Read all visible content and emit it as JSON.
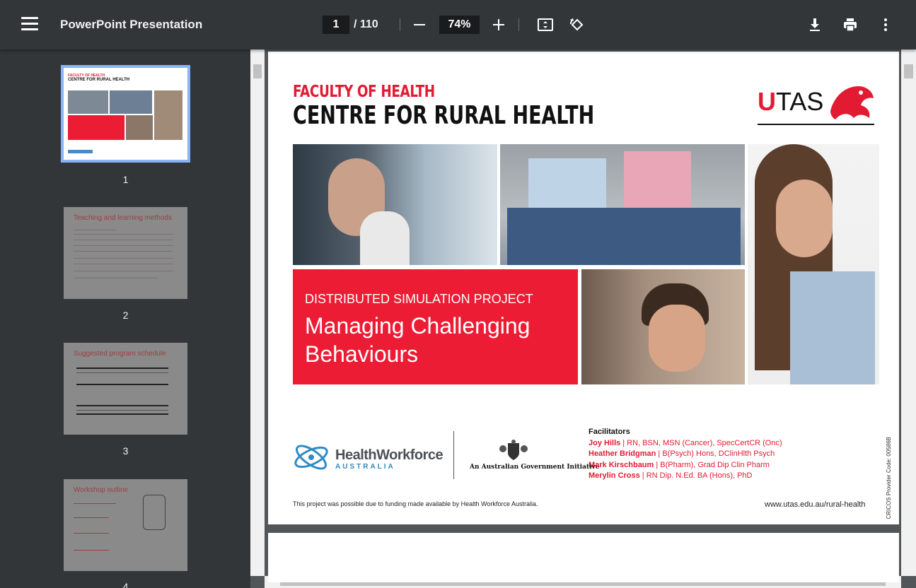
{
  "toolbar": {
    "title": "PowerPoint Presentation",
    "current_page": "1",
    "total_pages": "/ 110",
    "zoom": "74%"
  },
  "sidebar": {
    "thumbnails": [
      {
        "number": "1",
        "heading": ""
      },
      {
        "number": "2",
        "heading": "Teaching and learning methods"
      },
      {
        "number": "3",
        "heading": "Suggested program schedule"
      },
      {
        "number": "4",
        "heading": "Workshop outline"
      }
    ]
  },
  "slide": {
    "faculty": "FACULTY OF HEALTH",
    "centre": "CENTRE FOR RURAL HEALTH",
    "logo_u": "U",
    "logo_tas": "TAS",
    "project_label": "DISTRIBUTED SIMULATION PROJECT",
    "title_line1": "Managing Challenging",
    "title_line2": "Behaviours",
    "hwa_name": "HealthWorkforce",
    "hwa_sub": "AUSTRALIA",
    "gov_initiative": "An Australian Government Initiative",
    "facilitators_heading": "Facilitators",
    "facilitators": [
      {
        "name": "Joy Hills",
        "creds": " | RN, BSN, MSN (Cancer), SpecCertCR (Onc)"
      },
      {
        "name": "Heather Bridgman",
        "creds": " | B(Psych) Hons, DClinHlth Psych"
      },
      {
        "name": "Mark Kirschbaum",
        "creds": " | B(Pharm), Grad Dip Clin Pharm"
      },
      {
        "name": "Merylin Cross",
        "creds": " | RN Dip. N.Ed. BA (Hons), PhD"
      }
    ],
    "funding_note": "This project was possible due to funding made available by Health Workforce Australia.",
    "url": "www.utas.edu.au/rural-health",
    "cricos": "CRICOS Provider Code: 00586B"
  },
  "colors": {
    "toolbar_bg": "#323639",
    "viewer_bg": "#525659",
    "brand_red": "#e21b32",
    "selected_thumb": "#8ab4f8"
  }
}
